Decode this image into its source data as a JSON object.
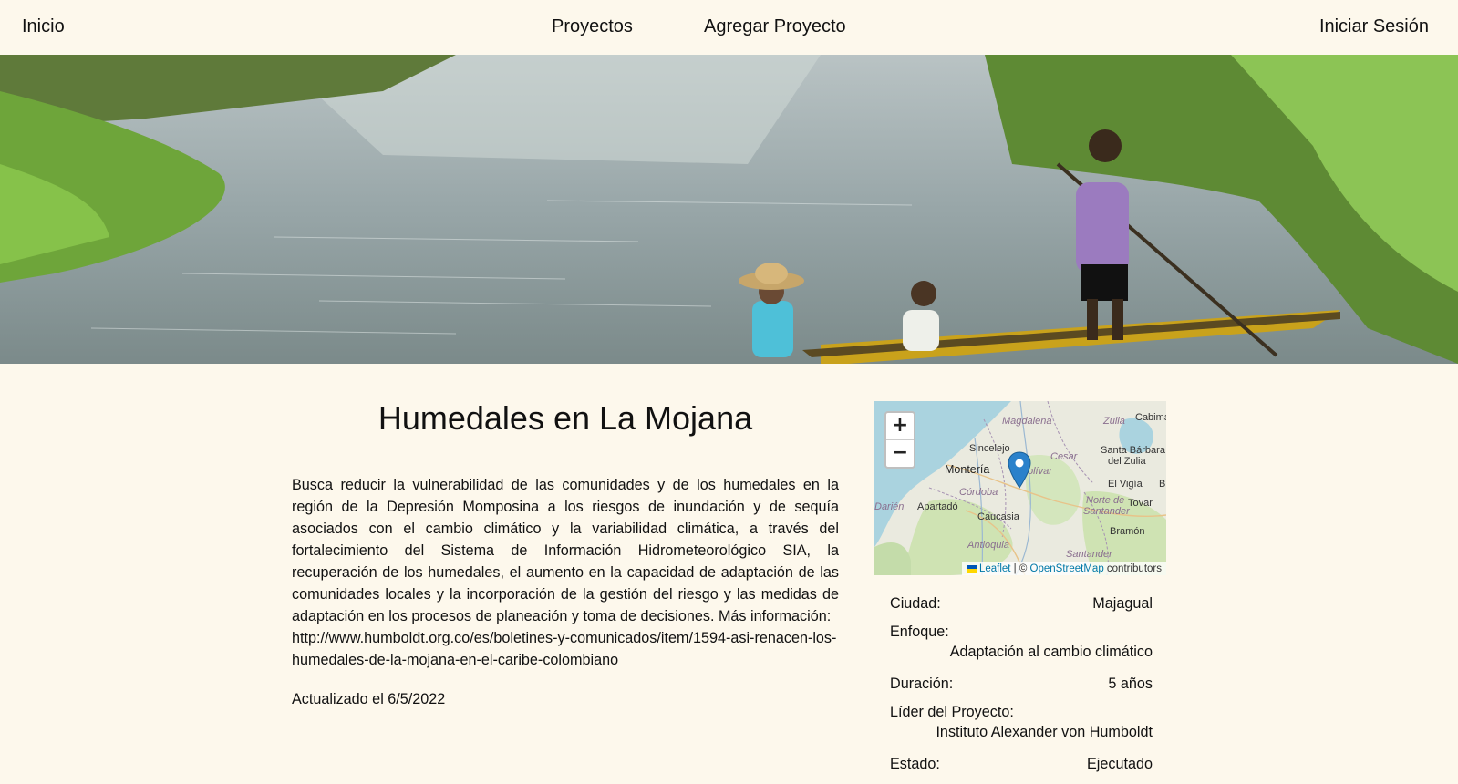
{
  "nav": {
    "home": "Inicio",
    "projects": "Proyectos",
    "add_project": "Agregar Proyecto",
    "login": "Iniciar Sesión"
  },
  "project": {
    "title": "Humedales en La Mojana",
    "description": "Busca reducir la vulnerabilidad de las comunidades y de los humedales en la región de la Depresión Momposina a los riesgos de inundación y de sequía asociados con el cambio climático y la variabilidad climática, a través del fortalecimiento del Sistema de Información Hidrometeorológico SIA, la recuperación de los humedales, el aumento en la capacidad de adaptación de las comunidades locales y la incorporación de la gestión del riesgo y las medidas de adaptación en los procesos de planeación y toma de decisiones. Más información:",
    "link": "http://www.humboldt.org.co/es/boletines-y-comunicados/item/1594-asi-renacen-los-humedales-de-la-mojana-en-el-caribe-colombiano",
    "updated": "Actualizado el 6/5/2022"
  },
  "map": {
    "zoom_in": "+",
    "zoom_out": "−",
    "attribution_leaflet": "Leaflet",
    "attribution_sep": " | © ",
    "attribution_osm": "OpenStreetMap",
    "attribution_tail": " contributors",
    "labels": {
      "magdalena": "Magdalena",
      "zulia": "Zulia",
      "cabimas": "Cabima",
      "sincelejo": "Sincelejo",
      "cesar": "Cesar",
      "santa_barbara": "Santa Bárbara",
      "del_zulia": "del Zulia",
      "monteria": "Montería",
      "bolivar": "olívar",
      "el_vigia": "El Vigía",
      "b": "B",
      "cordoba": "Córdoba",
      "darien": "Darién",
      "apartado": "Apartadó",
      "norte_de": "Norte de",
      "santander": "Santander",
      "tovar": "Tovar",
      "caucasia": "Caucasia",
      "bramon": "Bramón",
      "antioquia": "Antioquia",
      "santander2": "Santander"
    }
  },
  "details": {
    "city_label": "Ciudad:",
    "city": "Majagual",
    "focus_label": "Enfoque:",
    "focus": "Adaptación al cambio climático",
    "duration_label": "Duración:",
    "duration": "5 años",
    "leader_label": "Líder del Proyecto:",
    "leader": "Instituto Alexander von Humboldt",
    "status_label": "Estado:",
    "status": "Ejecutado"
  },
  "colors": {
    "background": "#fdf8ec",
    "link": "#0078a8",
    "marker": "#2a81cb"
  }
}
